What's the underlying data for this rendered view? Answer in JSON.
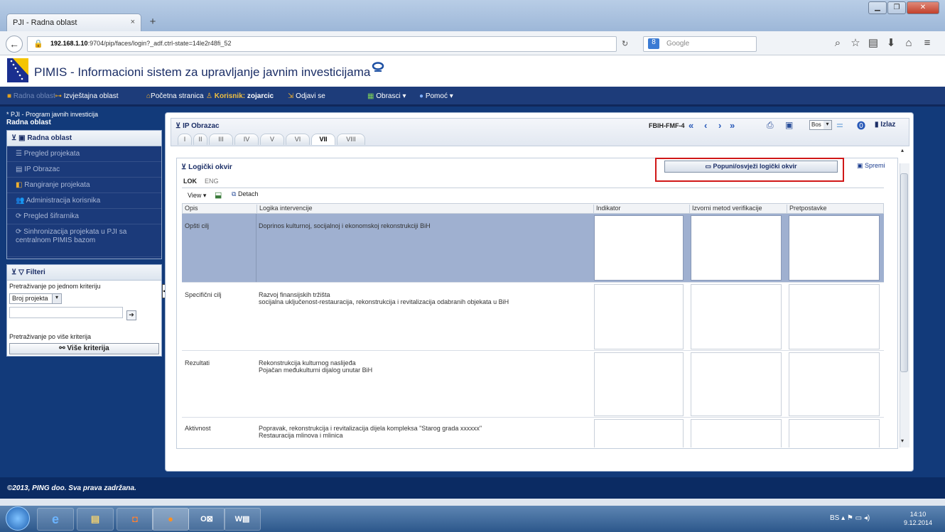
{
  "browser": {
    "tab_title": "PJI - Radna oblast",
    "url_host": "192.168.1.10",
    "url_rest": ":9704/pip/faces/login?_adf.ctrl-state=14le2r48fi_52",
    "search_placeholder": "Google",
    "tab_close": "×",
    "new_tab": "+"
  },
  "app": {
    "title": "PIMIS - Informacioni sistem za upravljanje javnim investicijama"
  },
  "menu": {
    "radna_oblast": "Radna oblast",
    "izvjestajna": "Izvještajna oblast",
    "pocetna": "Početna stranica",
    "korisnik_label": "Korisnik:",
    "korisnik_name": "zojarcic",
    "odjavi": "Odjavi se",
    "obrasci": "Obrasci",
    "pomoc": "Pomoć"
  },
  "left": {
    "breadcrumb1": "* PJI - Program javnih investicija",
    "breadcrumb2": "Radna oblast",
    "section_title": "Radna oblast",
    "items": [
      "Pregled projekata",
      "IP Obrazac",
      "Rangiranje projekata",
      "Administracija korisnika",
      "Pregled šifrarnika",
      "Sinhronizacija projekata u PJI sa centralnom PIMIS bazom"
    ],
    "filters_title": "Filteri",
    "filter_single_label": "Pretraživanje po jednom kriteriju",
    "filter_select": "Broj projekta",
    "filter_multi_label": "Pretraživanje po više kriterija",
    "filter_more_button": "Više kriterija"
  },
  "form": {
    "title": "IP Obrazac",
    "code": "FBIH-FMF-4",
    "lang_select": "Bos",
    "exit": "Izlaz",
    "tabs": [
      "I",
      "II",
      "III",
      "IV",
      "V",
      "VI",
      "VII",
      "VIII"
    ],
    "active_tab": "VII"
  },
  "logframe": {
    "title": "Logički okvir",
    "fill_button": "Popuni/osvježi logički okvir",
    "save": "Spremi",
    "tabs": [
      "LOK",
      "ENG"
    ],
    "view_label": "View",
    "detach_label": "Detach",
    "columns": [
      "Opis",
      "Logika intervencije",
      "Indikator",
      "Izvorni metod verifikacije",
      "Pretpostavke"
    ],
    "rows": [
      {
        "opis": "Opšti cilj",
        "logika": [
          "Doprinos kulturnoj, socijalnoj i ekonomskoj rekonstrukciji BiH"
        ]
      },
      {
        "opis": "Specifični cilj",
        "logika": [
          "Razvoj finansijskih tržišta",
          "socijalna uključenost-restauracija, rekonstrukcija i revitalizacija odabranih objekata u BiH"
        ]
      },
      {
        "opis": "Rezultati",
        "logika": [
          "Rekonstrukcija kulturnog naslijeđa",
          "Pojačan međukulturni dijalog unutar BiH"
        ]
      },
      {
        "opis": "Aktivnost",
        "logika": [
          "Popravak, rekonstrukcija i revitalizacija dijela kompleksa \"Starog grada xxxxxx\"",
          "Restauracija mlinova i mlinica"
        ]
      }
    ]
  },
  "footer": {
    "text": "©2013, PING doo. Sva prava zadržana."
  },
  "taskbar": {
    "lang": "BS",
    "time": "14:10",
    "date": "9.12.2014"
  },
  "colors": {
    "menu_bg": "#1d3c7a",
    "page_bg": "#123a7a",
    "selected_row": "#9fb0d0",
    "highlight_box": "#d01818"
  }
}
